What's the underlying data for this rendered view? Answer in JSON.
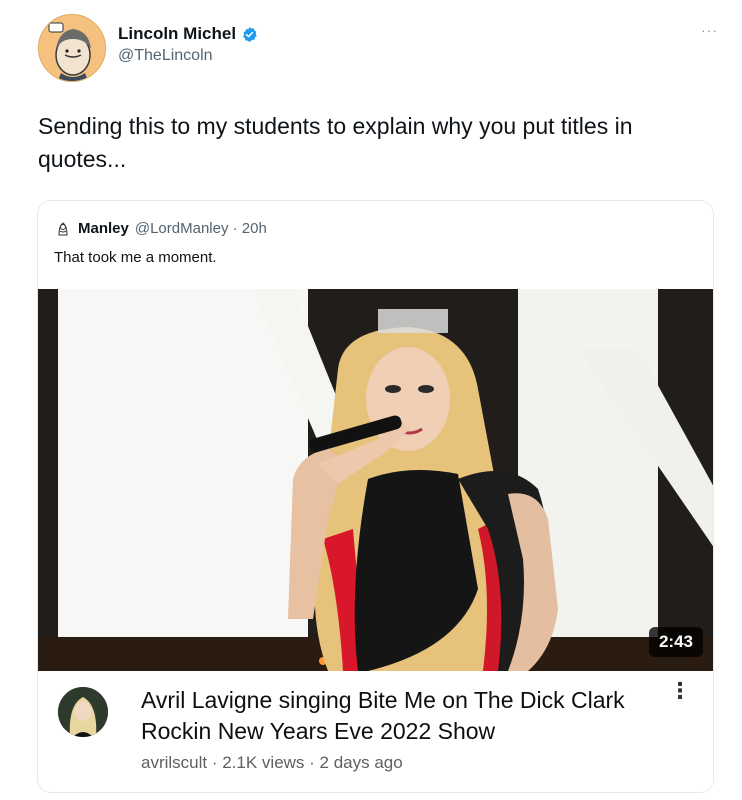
{
  "author": {
    "display_name": "Lincoln Michel",
    "handle": "@TheLincoln",
    "verified_icon": "verified-badge-icon",
    "more_icon": "more-options-icon",
    "more_glyph": "···"
  },
  "tweet": {
    "text": "Sending this to my students to explain why you put titles in quotes..."
  },
  "quoted_tweet": {
    "name": "Manley",
    "meta": "@LordManley · 20h",
    "text": "That took me a moment."
  },
  "video": {
    "duration": "2:43",
    "title": "Avril Lavigne singing Bite Me on The Dick Clark Rockin New Years Eve 2022 Show",
    "channel_meta": "avrilscult · 2.1K views · 2 days ago",
    "kebab_glyph": "⋮"
  },
  "colors": {
    "verified_blue": "#1d9bf0",
    "text_primary": "#0f1419",
    "text_secondary": "#536471"
  }
}
